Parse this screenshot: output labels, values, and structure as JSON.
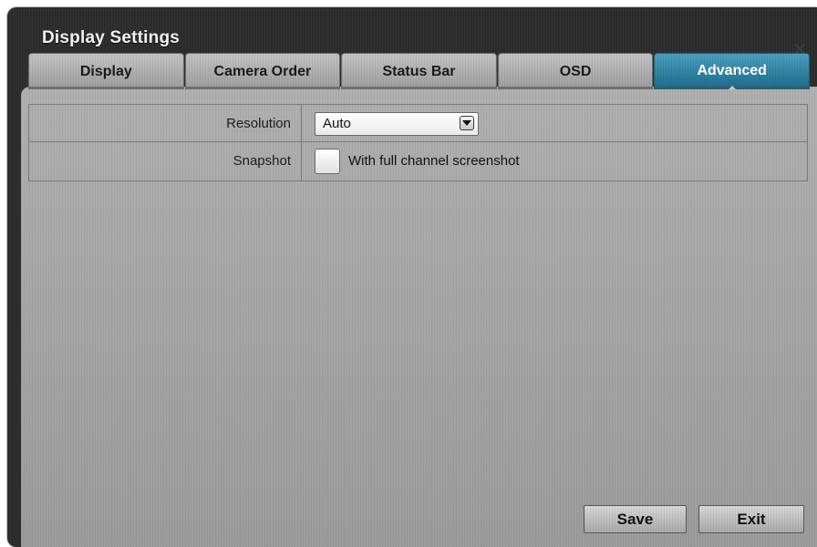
{
  "window": {
    "title": "Display Settings",
    "close_glyph": "✕"
  },
  "tabs": [
    {
      "label": "Display",
      "active": false
    },
    {
      "label": "Camera Order",
      "active": false
    },
    {
      "label": "Status Bar",
      "active": false
    },
    {
      "label": "OSD",
      "active": false
    },
    {
      "label": "Advanced",
      "active": true
    }
  ],
  "form": {
    "resolution": {
      "label": "Resolution",
      "value": "Auto"
    },
    "snapshot": {
      "label": "Snapshot",
      "checked": false,
      "option_label": "With full channel screenshot"
    }
  },
  "buttons": {
    "save_label": "Save",
    "exit_label": "Exit"
  },
  "colors": {
    "active_tab": "#2a7f9f",
    "panel": "#a4a4a4",
    "window_frame": "#2b2b2b"
  }
}
